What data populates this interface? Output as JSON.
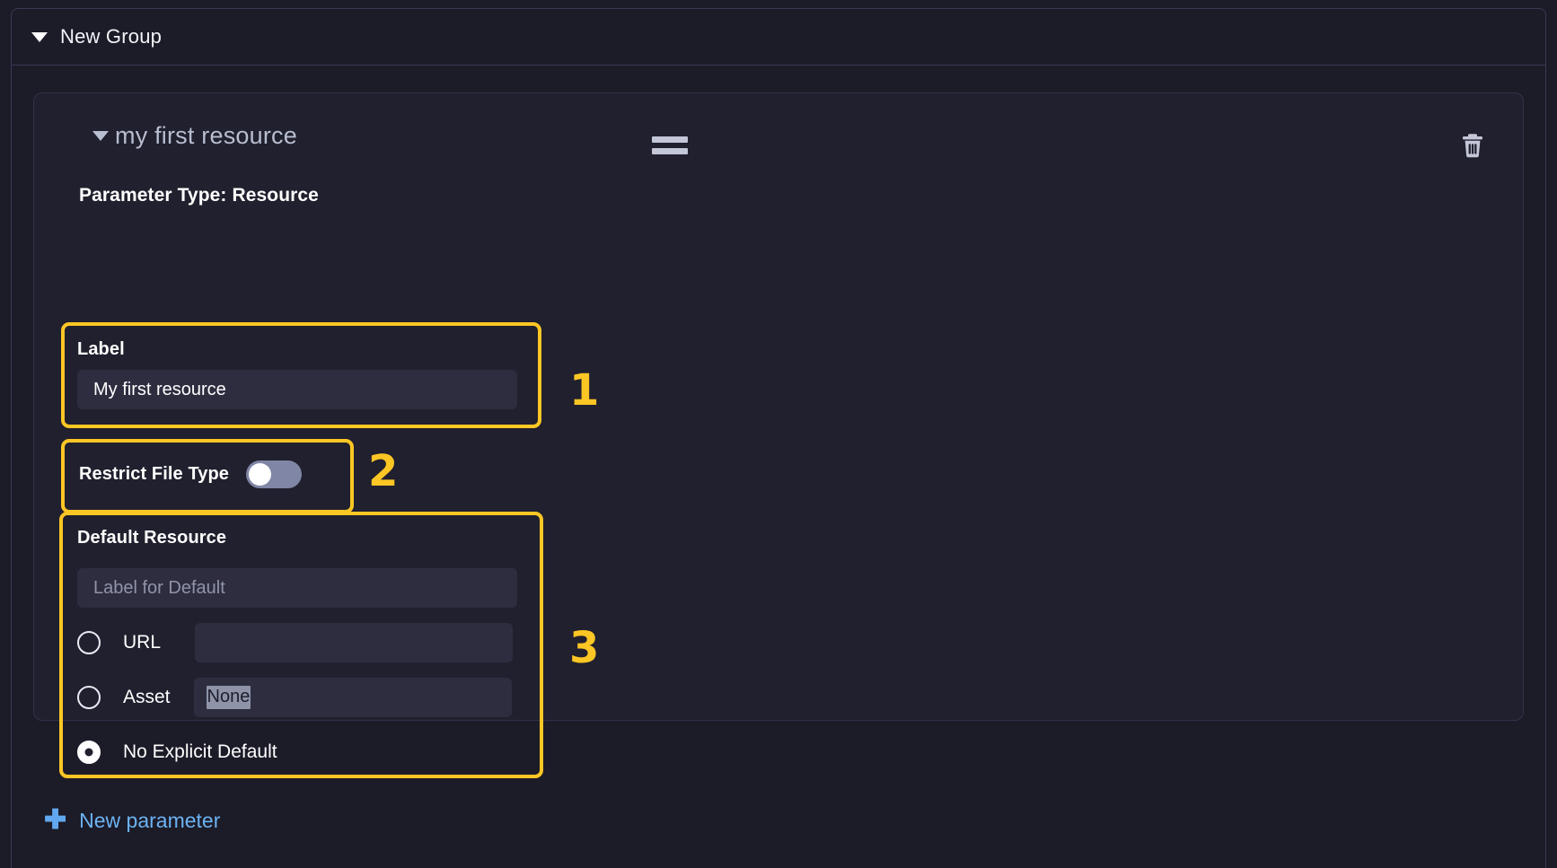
{
  "group": {
    "title": "New Group",
    "collapse_icon": "triangle-down-icon"
  },
  "resource": {
    "title": "my first resource",
    "collapse_icon": "triangle-down-icon",
    "drag_handle_icon": "drag-handle-icon",
    "delete_icon": "trash-icon",
    "parameter_type": "Parameter Type: Resource"
  },
  "label_field": {
    "label": "Label",
    "value": "My first resource",
    "placeholder": ""
  },
  "restrict_file_type": {
    "label": "Restrict File Type",
    "toggle_state": "off"
  },
  "default_resource": {
    "title": "Default Resource",
    "default_label_placeholder": "Label for Default",
    "default_label_value": "",
    "options": [
      {
        "label": "URL",
        "selected": false,
        "input_value": "",
        "input_placeholder": ""
      },
      {
        "label": "Asset",
        "selected": false,
        "select_value": "None",
        "chevron_icon": "chevron-down-icon"
      },
      {
        "label": "No Explicit Default",
        "selected": true
      }
    ]
  },
  "footer": {
    "new_parameter_label": "New parameter",
    "plus_icon": "plus-icon"
  },
  "annotations": {
    "numbers": [
      "1",
      "2",
      "3"
    ],
    "highlight_color": "#fcc624"
  },
  "colors": {
    "page_background": "#1c1b28",
    "card_background": "#20202e",
    "input_background": "#2e2d40",
    "accent_highlight": "#fcc624",
    "link_blue": "#6cb3f2",
    "muted_text": "#b8bdd0"
  }
}
